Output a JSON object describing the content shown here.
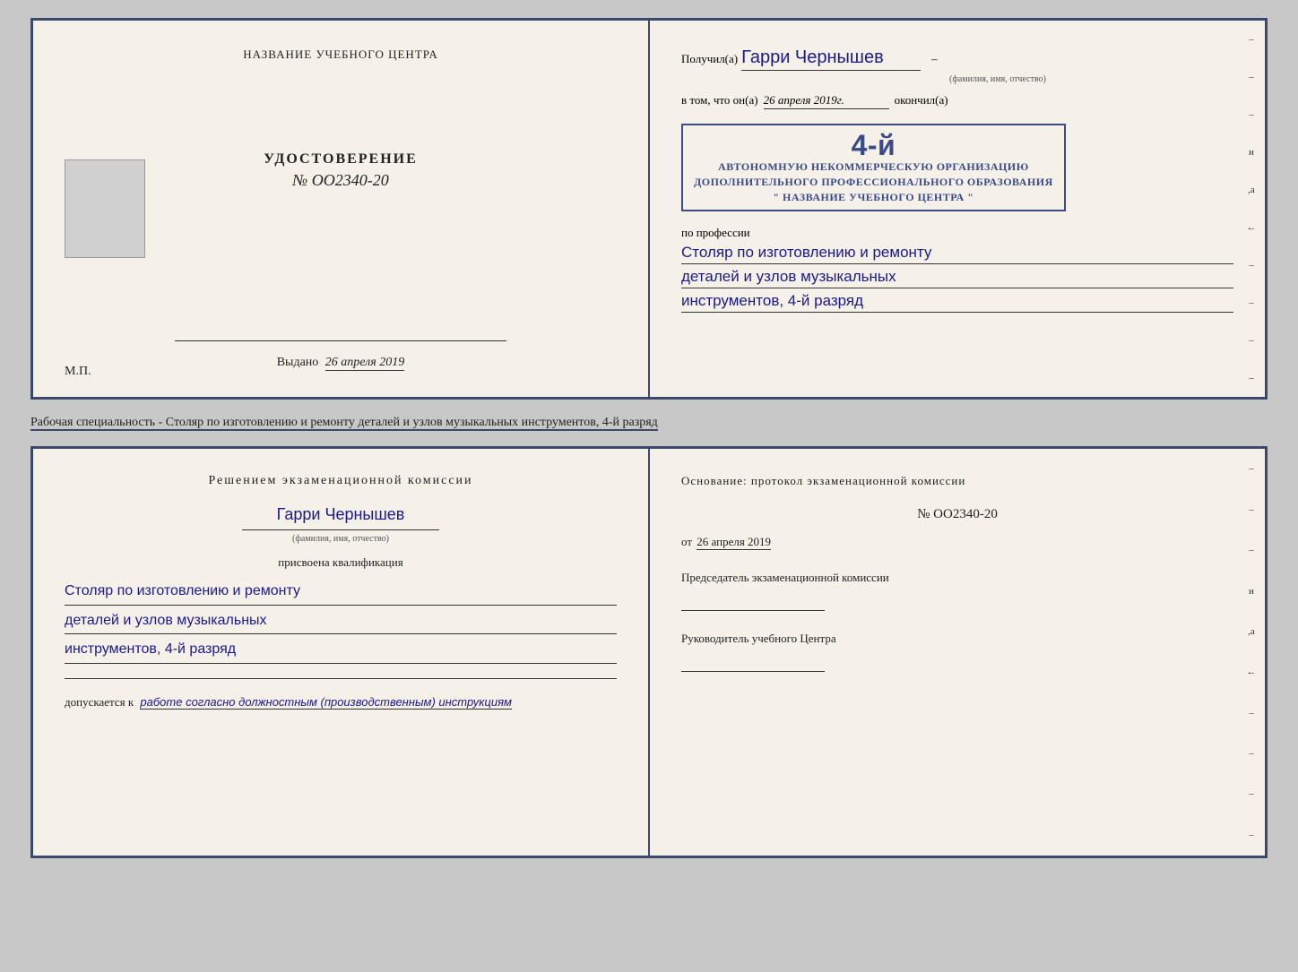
{
  "top_document": {
    "left": {
      "header": "НАЗВАНИЕ УЧЕБНОГО ЦЕНТРА",
      "title": "УДОСТОВЕРЕНИЕ",
      "number": "№ OO2340-20",
      "vydano_label": "Выдано",
      "vydano_date": "26 апреля 2019",
      "mp_label": "М.П."
    },
    "right": {
      "poluchil_label": "Получил(а)",
      "recipient_name": "Гарри Чернышев",
      "fio_hint": "(фамилия, имя, отчество)",
      "vtom_label": "в том, что он(а)",
      "vtom_date": "26 апреля 2019г.",
      "okonchil_label": "окончил(а)",
      "stamp_line1": "АВТОНОМНУЮ НЕКОММЕРЧЕСКУЮ ОРГАНИЗАЦИЮ",
      "stamp_line2": "ДОПОЛНИТЕЛЬНОГО ПРОФЕССИОНАЛЬНОГО ОБРАЗОВАНИЯ",
      "stamp_line3": "\" НАЗВАНИЕ УЧЕБНОГО ЦЕНТРА \"",
      "stamp_bignum": "4-й",
      "po_professii_label": "по профессии",
      "profession_line1": "Столяр по изготовлению и ремонту",
      "profession_line2": "деталей и узлов музыкальных",
      "profession_line3": "инструментов, 4-й разряд",
      "dashes": [
        "-",
        "-",
        "-",
        "и",
        ",а",
        "←",
        "-",
        "-",
        "-",
        "-"
      ]
    }
  },
  "subtitle": {
    "text": "Рабочая специальность - Столяр по изготовлению и ремонту деталей и узлов музыкальных инструментов, 4-й разряд"
  },
  "bottom_document": {
    "left": {
      "resheniem_header": "Решением  экзаменационной  комиссии",
      "person_name": "Гарри Чернышев",
      "fio_hint": "(фамилия, имя, отчество)",
      "prisvoena_label": "присвоена квалификация",
      "qualification_line1": "Столяр по изготовлению и ремонту",
      "qualification_line2": "деталей и узлов музыкальных",
      "qualification_line3": "инструментов, 4-й разряд",
      "dopuskaetsya_label": "допускается к",
      "dopuskaetsya_value": "работе согласно должностным (производственным) инструкциям"
    },
    "right": {
      "osnovanie_label": "Основание: протокол  экзаменационной  комиссии",
      "protocol_num": "№  OO2340-20",
      "protocol_date_prefix": "от",
      "protocol_date": "26 апреля 2019",
      "predsedatel_label": "Председатель экзаменационной комиссии",
      "rukovoditel_label": "Руководитель учебного Центра",
      "dashes": [
        "-",
        "-",
        "-",
        "и",
        ",а",
        "←",
        "-",
        "-",
        "-",
        "-"
      ]
    }
  }
}
